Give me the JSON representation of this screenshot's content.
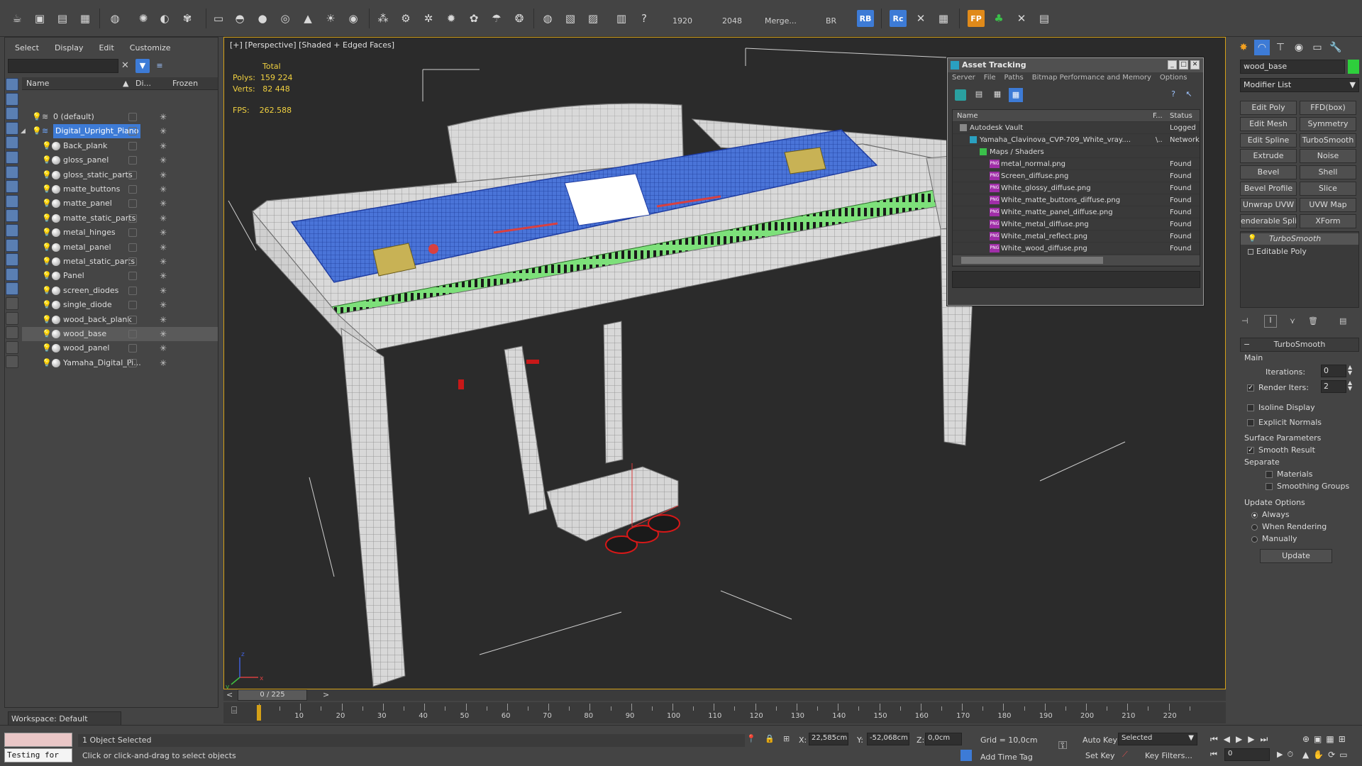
{
  "toolbar": {
    "render_width": "1920",
    "render_height": "2048",
    "merge_label": "Merge...",
    "br_label": "BR",
    "rb_label": "RB",
    "rc_label": "Rc",
    "fp_label": "FP",
    "help_label": "?"
  },
  "explorer": {
    "menu": [
      "Select",
      "Display",
      "Edit",
      "Customize"
    ],
    "col_name": "Name",
    "col_display": "Di...",
    "col_frozen": "Frozen",
    "rows": [
      {
        "name": "0 (default)",
        "level": 0
      },
      {
        "name": "Digital_Upright_Piano",
        "level": 0
      },
      {
        "name": "Back_plank",
        "level": 1
      },
      {
        "name": "gloss_panel",
        "level": 1
      },
      {
        "name": "gloss_static_parts",
        "level": 1
      },
      {
        "name": "matte_buttons",
        "level": 1
      },
      {
        "name": "matte_panel",
        "level": 1
      },
      {
        "name": "matte_static_parts",
        "level": 1
      },
      {
        "name": "metal_hinges",
        "level": 1
      },
      {
        "name": "metal_panel",
        "level": 1
      },
      {
        "name": "metal_static_parts",
        "level": 1
      },
      {
        "name": "Panel",
        "level": 1
      },
      {
        "name": "screen_diodes",
        "level": 1
      },
      {
        "name": "single_diode",
        "level": 1
      },
      {
        "name": "wood_back_plank",
        "level": 1
      },
      {
        "name": "wood_base",
        "level": 1
      },
      {
        "name": "wood_panel",
        "level": 1
      },
      {
        "name": "Yamaha_Digital_Pi...",
        "level": 1
      }
    ],
    "workspace": "Workspace: Default"
  },
  "viewport": {
    "label": "[+] [Perspective] [Shaded + Edged Faces]",
    "stats_total": "Total",
    "polys_label": "Polys:",
    "polys_value": "159 224",
    "verts_label": "Verts:",
    "verts_value": "82 448",
    "fps_label": "FPS:",
    "fps_value": "262.588",
    "axis_x": "x",
    "axis_y": "y",
    "axis_z": "z"
  },
  "asset_tracking": {
    "title": "Asset Tracking",
    "menu": [
      "Server",
      "File",
      "Paths",
      "Bitmap Performance and Memory",
      "Options"
    ],
    "col_name": "Name",
    "col_f": "F...",
    "col_status": "Status",
    "rows": [
      {
        "name": "Autodesk Vault",
        "status": "Logged",
        "indent": 1
      },
      {
        "name": "Yamaha_Clavinova_CVP-709_White_vray....",
        "f": "\\..",
        "status": "Network",
        "indent": 2
      },
      {
        "name": "Maps / Shaders",
        "status": "",
        "indent": 3
      },
      {
        "name": "metal_normal.png",
        "status": "Found",
        "indent": 4
      },
      {
        "name": "Screen_diffuse.png",
        "status": "Found",
        "indent": 4
      },
      {
        "name": "White_glossy_diffuse.png",
        "status": "Found",
        "indent": 4
      },
      {
        "name": "White_matte_buttons_diffuse.png",
        "status": "Found",
        "indent": 4
      },
      {
        "name": "White_matte_panel_diffuse.png",
        "status": "Found",
        "indent": 4
      },
      {
        "name": "White_metal_diffuse.png",
        "status": "Found",
        "indent": 4
      },
      {
        "name": "White_metal_reflect.png",
        "status": "Found",
        "indent": 4
      },
      {
        "name": "White_wood_diffuse.png",
        "status": "Found",
        "indent": 4
      }
    ]
  },
  "command_panel": {
    "object_name": "wood_base",
    "modifier_list": "Modifier List",
    "buttons": [
      "Edit Poly",
      "FFD(box)",
      "Edit Mesh",
      "Symmetry",
      "Edit Spline",
      "TurboSmooth",
      "Extrude",
      "Noise",
      "Bevel",
      "Shell",
      "Bevel Profile",
      "Slice",
      "Unwrap UVW",
      "UVW Map",
      "enderable Splin",
      "XForm"
    ],
    "stack": [
      "TurboSmooth",
      "Editable Poly"
    ],
    "rollout_title": "TurboSmooth",
    "main_label": "Main",
    "iterations_label": "Iterations:",
    "iterations_value": "0",
    "render_iters_label": "Render Iters:",
    "render_iters_value": "2",
    "isoline_label": "Isoline Display",
    "explicit_normals_label": "Explicit Normals",
    "surface_params_label": "Surface Parameters",
    "smooth_result_label": "Smooth Result",
    "separate_label": "Separate",
    "materials_label": "Materials",
    "smoothing_groups_label": "Smoothing Groups",
    "update_options_label": "Update Options",
    "always_label": "Always",
    "when_rendering_label": "When Rendering",
    "manually_label": "Manually",
    "update_button": "Update"
  },
  "timeline": {
    "frame_readout": "0 / 225",
    "ticks": [
      "10",
      "20",
      "30",
      "40",
      "50",
      "60",
      "70",
      "80",
      "90",
      "100",
      "110",
      "120",
      "130",
      "140",
      "150",
      "160",
      "170",
      "180",
      "190",
      "200",
      "210",
      "220"
    ]
  },
  "statusbar": {
    "maxscript_text": "Testing for",
    "selected_text": "1 Object Selected",
    "prompt_text": "Click or click-and-drag to select objects",
    "x_label": "X:",
    "x_value": "22,585cm",
    "y_label": "Y:",
    "y_value": "-52,068cm",
    "z_label": "Z:",
    "z_value": "0,0cm",
    "grid_text": "Grid = 10,0cm",
    "add_time_tag": "Add Time Tag",
    "auto_key": "Auto Key",
    "set_key": "Set Key",
    "selected_dropdown": "Selected",
    "key_filters": "Key Filters...",
    "frame_value": "0"
  },
  "colors": {
    "accent": "#3d7bd6",
    "viewport_border": "#d4a017",
    "stats_text": "#f0d040",
    "wire_blue": "#2f5fc7",
    "key_green": "#7de07a",
    "pedal_red": "#c81818"
  }
}
